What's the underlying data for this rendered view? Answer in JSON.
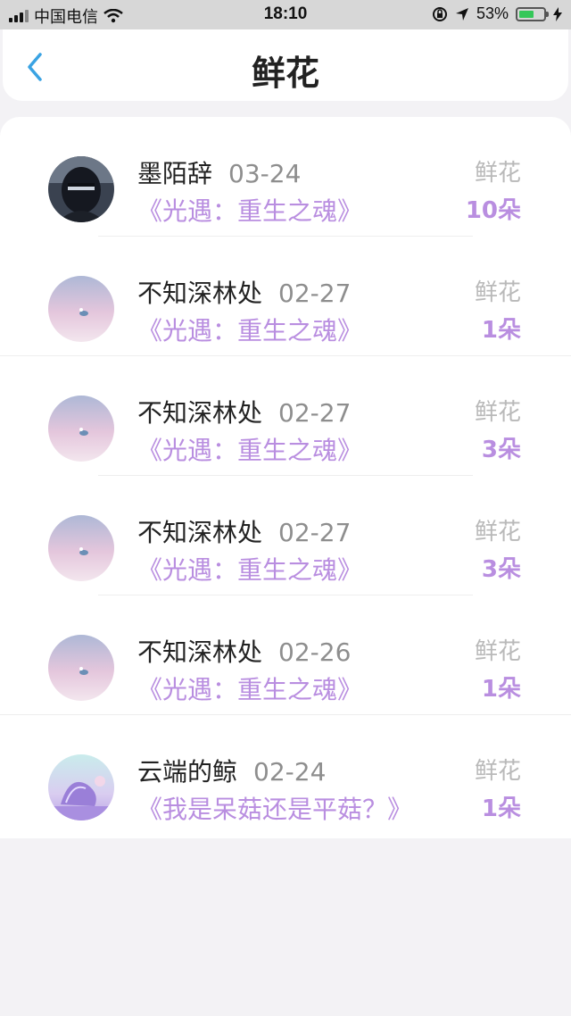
{
  "status_bar": {
    "carrier": "中国电信",
    "time": "18:10",
    "battery": "53%",
    "battery_level": 0.53
  },
  "header": {
    "title": "鲜花"
  },
  "flower_label": "鲜花",
  "items": [
    {
      "name": "墨陌辞",
      "date": "03-24",
      "game": "《光遇：重生之魂》",
      "count": "10朵",
      "avatar": "dark-hooded-avatar"
    },
    {
      "name": "不知深林处",
      "date": "02-27",
      "game": "《光遇：重生之魂》",
      "count": "1朵",
      "avatar": "pastel-sky-avatar"
    },
    {
      "name": "不知深林处",
      "date": "02-27",
      "game": "《光遇：重生之魂》",
      "count": "3朵",
      "avatar": "pastel-sky-avatar"
    },
    {
      "name": "不知深林处",
      "date": "02-27",
      "game": "《光遇：重生之魂》",
      "count": "3朵",
      "avatar": "pastel-sky-avatar"
    },
    {
      "name": "不知深林处",
      "date": "02-26",
      "game": "《光遇：重生之魂》",
      "count": "1朵",
      "avatar": "pastel-sky-avatar"
    },
    {
      "name": "云端的鲸",
      "date": "02-24",
      "game": "《我是呆菇还是平菇？》",
      "count": "1朵",
      "avatar": "purple-shell-avatar"
    }
  ],
  "colors": {
    "accent": "#b98ee0",
    "back_arrow": "#3aa3e3"
  }
}
